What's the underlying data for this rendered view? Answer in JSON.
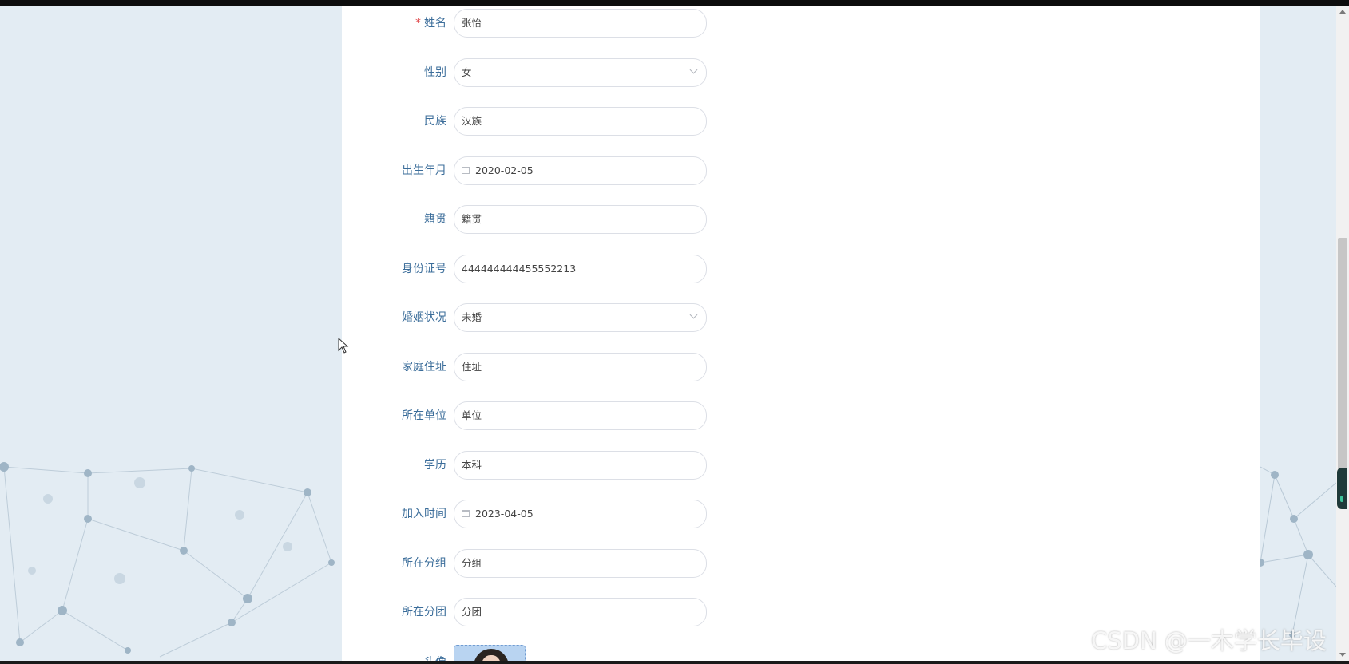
{
  "form": {
    "fields": [
      {
        "label": "姓名",
        "required": "*",
        "value": "张怡",
        "type": "text"
      },
      {
        "label": "性别",
        "value": "女",
        "type": "select"
      },
      {
        "label": "民族",
        "value": "汉族",
        "type": "text"
      },
      {
        "label": "出生年月",
        "value": "2020-02-05",
        "type": "date"
      },
      {
        "label": "籍贯",
        "value": "籍贯",
        "type": "text"
      },
      {
        "label": "身份证号",
        "value": "444444444455552213",
        "type": "text"
      },
      {
        "label": "婚姻状况",
        "value": "未婚",
        "type": "select"
      },
      {
        "label": "家庭住址",
        "value": "住址",
        "type": "text"
      },
      {
        "label": "所在单位",
        "value": "单位",
        "type": "text"
      },
      {
        "label": "学历",
        "value": "本科",
        "type": "text"
      },
      {
        "label": "加入时间",
        "value": "2023-04-05",
        "type": "date"
      },
      {
        "label": "所在分组",
        "value": "分组",
        "type": "text"
      },
      {
        "label": "所在分团",
        "value": "分团",
        "type": "text"
      }
    ],
    "avatar_label": "头像"
  },
  "watermark": "CSDN @一木学长毕设",
  "colors": {
    "label": "#3b6d9a",
    "required": "#e0484b",
    "background": "#e3ecf3",
    "panel": "#ffffff"
  },
  "icons": {
    "date_field": "calendar-icon",
    "select_field": "chevron-down-icon"
  }
}
